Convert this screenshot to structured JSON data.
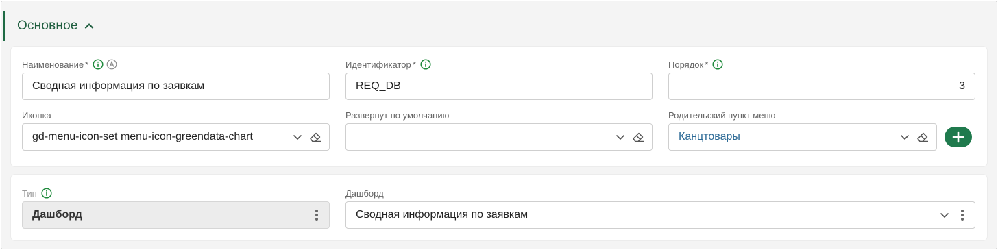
{
  "section": {
    "title": "Основное"
  },
  "fields": {
    "name": {
      "label": "Наименование",
      "required_mark": "*",
      "value": "Сводная информация по заявкам"
    },
    "identifier": {
      "label": "Идентификатор",
      "required_mark": "*",
      "value": "REQ_DB"
    },
    "order": {
      "label": "Порядок",
      "required_mark": "*",
      "value": "3"
    },
    "icon": {
      "label": "Иконка",
      "value": "gd-menu-icon-set menu-icon-greendata-chart"
    },
    "expanded_default": {
      "label": "Развернут по умолчанию",
      "value": ""
    },
    "parent_menu": {
      "label": "Родительский пункт меню",
      "value": "Канцтовары"
    },
    "type": {
      "label": "Тип",
      "value": "Дашборд"
    },
    "dashboard": {
      "label": "Дашборд",
      "value": "Сводная информация по заявкам"
    }
  },
  "icons": {
    "info": "info-icon",
    "auto": "auto-icon",
    "chevron_down": "chevron-down-icon",
    "eraser": "eraser-icon",
    "kebab": "kebab-menu-icon",
    "add": "plus-icon",
    "collapse": "chevron-up-icon"
  },
  "colors": {
    "accent": "#1f7a4d",
    "title": "#1f5e3f",
    "link": "#2c6a96"
  }
}
